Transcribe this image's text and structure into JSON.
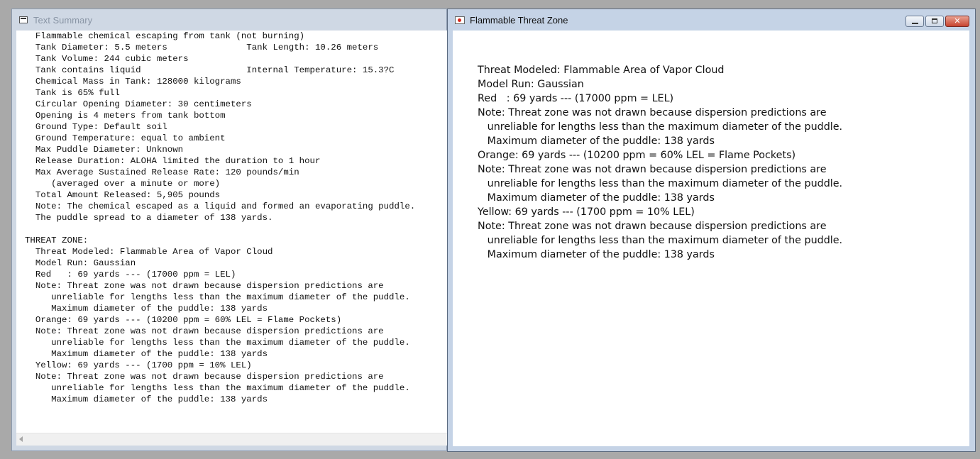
{
  "summary_window": {
    "title": "Text Summary",
    "lines": [
      "  Flammable chemical escaping from tank (not burning)",
      "  Tank Diameter: 5.5 meters               Tank Length: 10.26 meters",
      "  Tank Volume: 244 cubic meters",
      "  Tank contains liquid                    Internal Temperature: 15.3?C",
      "  Chemical Mass in Tank: 128000 kilograms",
      "  Tank is 65% full",
      "  Circular Opening Diameter: 30 centimeters",
      "  Opening is 4 meters from tank bottom",
      "  Ground Type: Default soil",
      "  Ground Temperature: equal to ambient",
      "  Max Puddle Diameter: Unknown",
      "  Release Duration: ALOHA limited the duration to 1 hour",
      "  Max Average Sustained Release Rate: 120 pounds/min",
      "     (averaged over a minute or more)",
      "  Total Amount Released: 5,905 pounds",
      "  Note: The chemical escaped as a liquid and formed an evaporating puddle.",
      "  The puddle spread to a diameter of 138 yards.",
      "",
      "THREAT ZONE:",
      "  Threat Modeled: Flammable Area of Vapor Cloud",
      "  Model Run: Gaussian",
      "  Red   : 69 yards --- (17000 ppm = LEL)",
      "  Note: Threat zone was not drawn because dispersion predictions are",
      "     unreliable for lengths less than the maximum diameter of the puddle.",
      "     Maximum diameter of the puddle: 138 yards",
      "  Orange: 69 yards --- (10200 ppm = 60% LEL = Flame Pockets)",
      "  Note: Threat zone was not drawn because dispersion predictions are",
      "     unreliable for lengths less than the maximum diameter of the puddle.",
      "     Maximum diameter of the puddle: 138 yards",
      "  Yellow: 69 yards --- (1700 ppm = 10% LEL)",
      "  Note: Threat zone was not drawn because dispersion predictions are",
      "     unreliable for lengths less than the maximum diameter of the puddle.",
      "     Maximum diameter of the puddle: 138 yards"
    ]
  },
  "zone_window": {
    "title": "Flammable Threat Zone",
    "controls": {
      "minimize": "",
      "maximize": "",
      "close": "✕"
    },
    "lines": [
      "Threat Modeled: Flammable Area of Vapor Cloud",
      "Model Run: Gaussian",
      "Red   : 69 yards --- (17000 ppm = LEL)",
      "Note: Threat zone was not drawn because dispersion predictions are",
      "   unreliable for lengths less than the maximum diameter of the puddle.",
      "   Maximum diameter of the puddle: 138 yards",
      "Orange: 69 yards --- (10200 ppm = 60% LEL = Flame Pockets)",
      "Note: Threat zone was not drawn because dispersion predictions are",
      "   unreliable for lengths less than the maximum diameter of the puddle.",
      "   Maximum diameter of the puddle: 138 yards",
      "Yellow: 69 yards --- (1700 ppm = 10% LEL)",
      "Note: Threat zone was not drawn because dispersion predictions are",
      "   unreliable for lengths less than the maximum diameter of the puddle.",
      "   Maximum diameter of the puddle: 138 yards"
    ]
  },
  "icons": {
    "summary_window": "text-document-icon",
    "zone_window": "threat-zone-flag-icon",
    "scroll_left": "scroll-left-arrow-icon"
  },
  "colors": {
    "desktop": "#a9a9a9",
    "inactive_frame": "#cfd8e4",
    "active_frame": "#c5d3e6",
    "close_button": "#c7432f"
  }
}
